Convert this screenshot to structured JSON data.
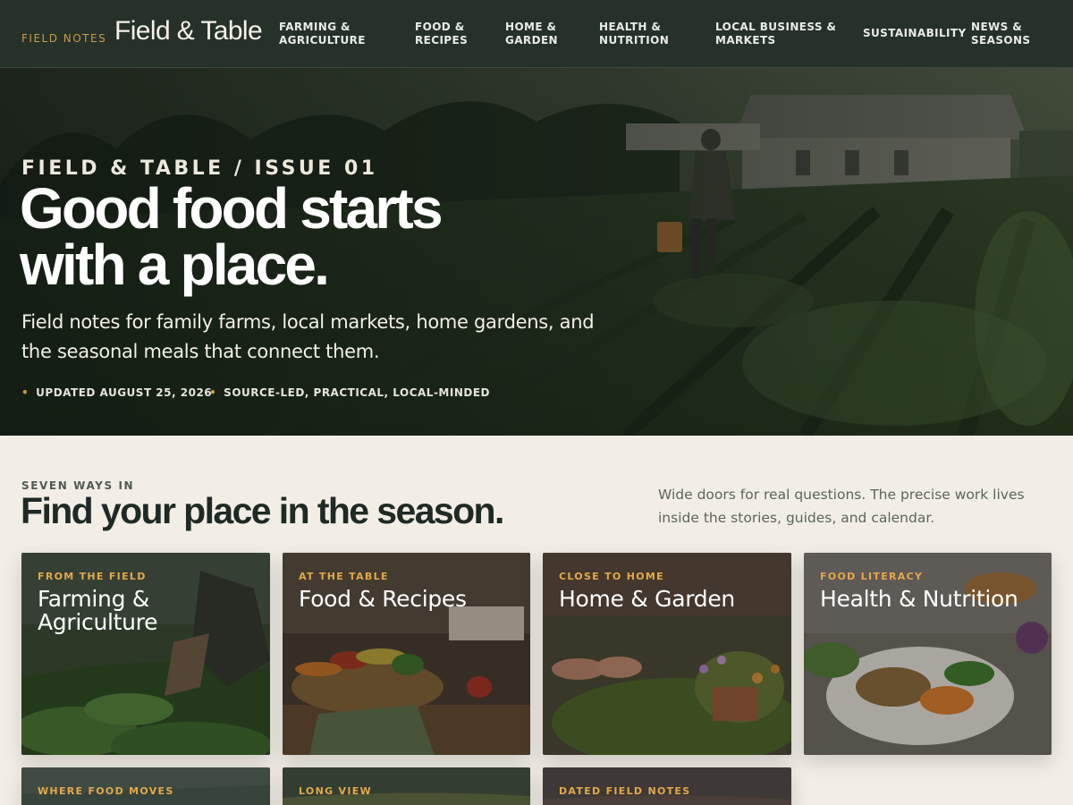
{
  "brand": {
    "kicker": "FIELD NOTES",
    "name": "Field & Table"
  },
  "nav": [
    "FARMING & AGRICULTURE",
    "FOOD & RECIPES",
    "HOME & GARDEN",
    "HEALTH & NUTRITION",
    "LOCAL BUSINESS & MARKETS",
    "SUSTAINABILITY",
    "NEWS & SEASONS"
  ],
  "hero": {
    "kicker": "FIELD & TABLE / ISSUE 01",
    "title": "Good food starts with a place.",
    "subtitle": "Field notes for family farms, local markets, home gardens, and the seasonal meals that connect them.",
    "meta": [
      "UPDATED AUGUST 25, 2026",
      "SOURCE-LED, PRACTICAL, LOCAL-MINDED"
    ]
  },
  "section": {
    "kicker": "SEVEN WAYS IN",
    "title": "Find your place in the season.",
    "description": "Wide doors for real questions. The precise work lives inside the stories, guides, and calendar."
  },
  "cards": [
    {
      "kicker": "FROM THE FIELD",
      "title": "Farming & Agriculture"
    },
    {
      "kicker": "AT THE TABLE",
      "title": "Food & Recipes"
    },
    {
      "kicker": "CLOSE TO HOME",
      "title": "Home & Garden"
    },
    {
      "kicker": "FOOD LITERACY",
      "title": "Health & Nutrition"
    },
    {
      "kicker": "WHERE FOOD MOVES",
      "title": ""
    },
    {
      "kicker": "LONG VIEW",
      "title": ""
    },
    {
      "kicker": "DATED FIELD NOTES",
      "title": ""
    }
  ],
  "colors": {
    "nav_bg": "#253129",
    "accent": "#c99a4a",
    "page_bg": "#f2eee6"
  }
}
